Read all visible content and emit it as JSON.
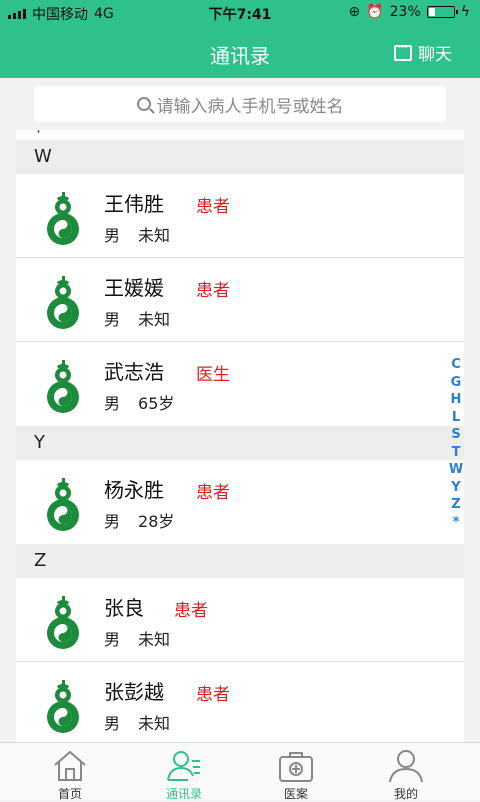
{
  "status_bar": {
    "carrier": "中国移动",
    "network": "4G",
    "time": "下午7:41",
    "battery": "23%"
  },
  "header": {
    "title": "通讯录",
    "chat_label": "聊天"
  },
  "search": {
    "placeholder": "请输入病人手机号或姓名"
  },
  "scroll_indicator": "·",
  "sections": [
    {
      "letter": "W",
      "contacts": [
        {
          "name": "王伟胜",
          "role": "患者",
          "gender": "男",
          "age": "未知"
        },
        {
          "name": "王媛媛",
          "role": "患者",
          "gender": "男",
          "age": "未知"
        },
        {
          "name": "武志浩",
          "role": "医生",
          "gender": "男",
          "age": "65岁"
        }
      ]
    },
    {
      "letter": "Y",
      "contacts": [
        {
          "name": "杨永胜",
          "role": "患者",
          "gender": "男",
          "age": "28岁"
        }
      ]
    },
    {
      "letter": "Z",
      "contacts": [
        {
          "name": "张良",
          "role": "患者",
          "gender": "男",
          "age": "未知"
        },
        {
          "name": "张彭越",
          "role": "患者",
          "gender": "男",
          "age": "未知"
        }
      ]
    }
  ],
  "alphabet_index": [
    "C",
    "G",
    "H",
    "L",
    "S",
    "T",
    "W",
    "Y",
    "Z",
    "*"
  ],
  "tabs": [
    {
      "label": "首页",
      "icon": "home-icon",
      "active": false
    },
    {
      "label": "通讯录",
      "icon": "contacts-icon",
      "active": true
    },
    {
      "label": "医案",
      "icon": "medical-kit-icon",
      "active": false
    },
    {
      "label": "我的",
      "icon": "profile-icon",
      "active": false
    }
  ],
  "colors": {
    "brand": "#2fc18c",
    "role_tag": "#e02020",
    "index": "#2a7fd4",
    "avatar": "#1a8c3c"
  }
}
